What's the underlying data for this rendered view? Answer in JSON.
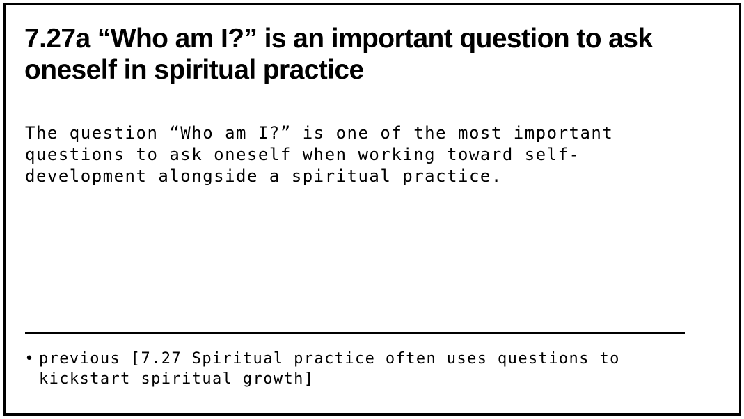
{
  "note": {
    "title": "7.27a “Who am I?” is an important question to ask oneself in spiritual practice",
    "body": "The question “Who am I?” is one of the most important questions to ask oneself when working toward self-development alongside a spiritual practice."
  },
  "links": {
    "bullet": "•",
    "items": [
      {
        "label": "previous [7.27 Spiritual practice often uses questions to kickstart spiritual growth]"
      }
    ]
  }
}
